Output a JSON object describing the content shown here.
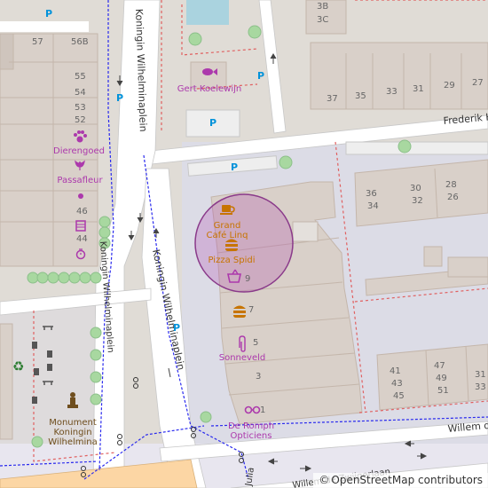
{
  "map": {
    "streets": {
      "wilhelmina_left": "Koningin Wilhelminaplein",
      "wilhelmina_right": "Koningin Wilhelminaplein",
      "wilhelmina_west": "Koningin Wilhelminaplein",
      "frederik": "Frederik H",
      "willem_right": "Willem de",
      "willem_bottom": "Willem de Zwijgerlaan",
      "julia": "Julia"
    },
    "pois": {
      "grand_cafe": "Grand\nCafé Linq",
      "grand_cafe_line1": "Grand",
      "grand_cafe_line2": "Café Linq",
      "pizza": "Pizza Spidi",
      "dierengoed": "Dierengoed",
      "passafleur": "Passafleur",
      "gert": "Gert Koelewijn",
      "sonneveld": "Sonneveld",
      "de_romph_line1": "De Romph",
      "de_romph_line2": "Opticiens",
      "monument_line1": "Monument",
      "monument_line2": "Koningin",
      "monument_line3": "Wilhelmina"
    },
    "house_numbers": {
      "n57": "57",
      "n56b": "56B",
      "n55": "55",
      "n54": "54",
      "n53": "53",
      "n52": "52",
      "n46": "46",
      "n44": "44",
      "n9": "9",
      "n7": "7",
      "n5": "5",
      "n3": "3",
      "n1": "1",
      "n3b": "3B",
      "n3c": "3C",
      "n37": "37",
      "n35": "35",
      "n33": "33",
      "n31": "31",
      "n29": "29",
      "n27": "27",
      "n36": "36",
      "n34": "34",
      "n30": "30",
      "n32": "32",
      "n28": "28",
      "n26": "26",
      "n41": "41",
      "n43": "43",
      "n45": "45",
      "n47": "47",
      "n49": "49",
      "n51": "51",
      "n31b": "31",
      "n33b": "33"
    },
    "parking_label": "P",
    "colors": {
      "building": "#d9d0c9",
      "building_edge": "#c4b6ab",
      "road": "#ffffff",
      "footway_area": "#dddde8",
      "primary_road": "#fcd6a4",
      "water": "#aad3df",
      "poi_purple": "#ac39ac",
      "poi_food": "#c77400",
      "highlight": "#8a3a8a",
      "tree": "#a8d8a0"
    },
    "icons": [
      "cafe-icon",
      "fastfood-icon",
      "shopping-basket-icon",
      "pet-icon",
      "florist-icon",
      "fish-icon",
      "optician-icon",
      "paperclip-icon",
      "monument-icon",
      "recycling-icon",
      "waste-basket-icon",
      "bench-icon",
      "parking-icon",
      "bicycle-icon"
    ]
  },
  "attribution": {
    "prefix": "©",
    "text": "OpenStreetMap contributors"
  }
}
